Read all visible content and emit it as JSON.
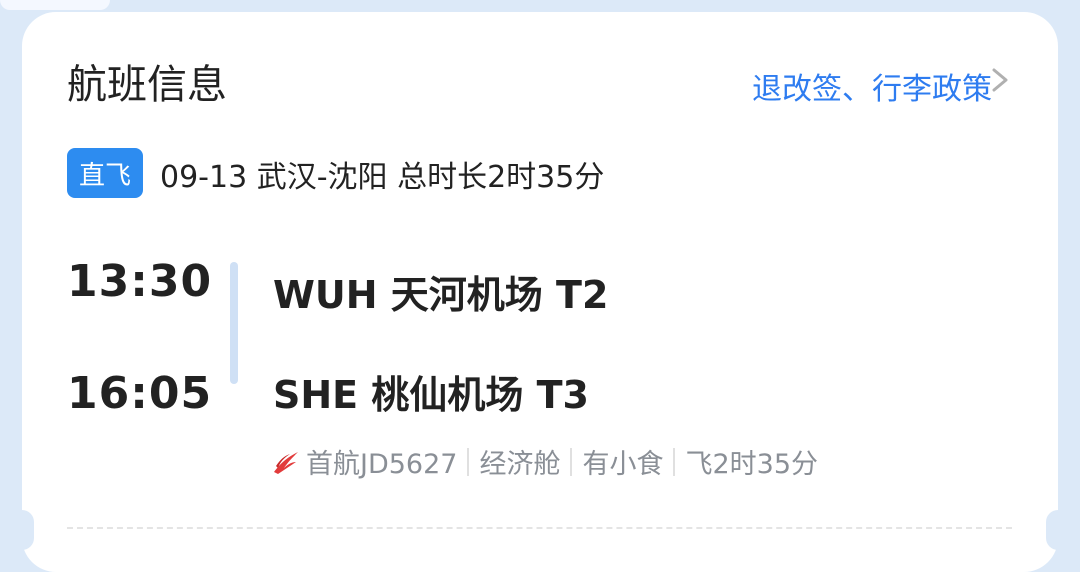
{
  "card": {
    "title": "航班信息",
    "policy_link": "退改签、行李政策"
  },
  "flight": {
    "badge": "直飞",
    "summary": "09-13 武汉-沈阳 总时长2时35分",
    "departure": {
      "time": "13:30",
      "airport": "WUH 天河机场 T2"
    },
    "arrival": {
      "time": "16:05",
      "airport": "SHE 桃仙机场 T3"
    },
    "details": {
      "airline_flight": "首航JD5627",
      "cabin": "经济舱",
      "meal": "有小食",
      "duration": "飞2时35分"
    }
  },
  "colors": {
    "accent": "#2e7cf0",
    "badge_bg": "#2d8cf0",
    "airline_logo": "#e23b3b"
  },
  "icons": {
    "policy_chevron": "chevron-right-icon",
    "airline": "capital-airlines-logo-icon"
  }
}
